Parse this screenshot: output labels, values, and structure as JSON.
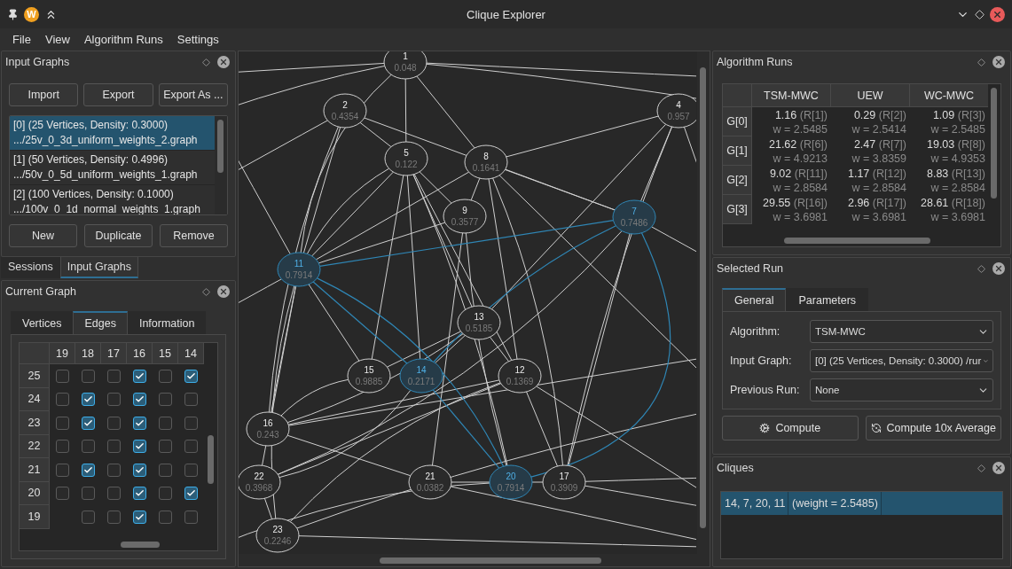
{
  "window": {
    "logo": "W",
    "title": "Clique Explorer"
  },
  "menu": [
    "File",
    "View",
    "Algorithm Runs",
    "Settings"
  ],
  "input_graphs": {
    "title": "Input Graphs",
    "top_buttons": [
      "Import",
      "Export",
      "Export As ..."
    ],
    "items": [
      {
        "line1": "[0] (25 Vertices, Density: 0.3000)",
        "line2": ".../25v_0_3d_uniform_weights_2.graph",
        "selected": true
      },
      {
        "line1": "[1] (50 Vertices, Density: 0.4996)",
        "line2": ".../50v_0_5d_uniform_weights_1.graph",
        "selected": false
      },
      {
        "line1": "[2] (100 Vertices, Density: 0.1000)",
        "line2": ".../100v_0_1d_normal_weights_1.graph",
        "selected": false
      }
    ],
    "bottom_buttons": [
      "New",
      "Duplicate",
      "Remove"
    ]
  },
  "left_tabs": [
    {
      "label": "Sessions",
      "selected": false
    },
    {
      "label": "Input Graphs",
      "selected": true
    }
  ],
  "current_graph": {
    "title": "Current Graph",
    "tabs": [
      {
        "label": "Vertices",
        "selected": false
      },
      {
        "label": "Edges",
        "selected": true
      },
      {
        "label": "Information",
        "selected": false
      }
    ],
    "columns": [
      "19",
      "18",
      "17",
      "16",
      "15",
      "14"
    ],
    "rows": [
      {
        "label": "25",
        "cells": [
          {
            "kind": "checkbox",
            "checked": false
          },
          {
            "kind": "checkbox",
            "checked": false
          },
          {
            "kind": "checkbox",
            "checked": false
          },
          {
            "kind": "checkbox",
            "checked": true
          },
          {
            "kind": "checkbox",
            "checked": false
          },
          {
            "kind": "checkbox",
            "checked": true
          }
        ]
      },
      {
        "label": "24",
        "cells": [
          {
            "kind": "checkbox",
            "checked": false
          },
          {
            "kind": "checkbox",
            "checked": true
          },
          {
            "kind": "checkbox",
            "checked": false
          },
          {
            "kind": "checkbox",
            "checked": true
          },
          {
            "kind": "checkbox",
            "checked": false
          },
          {
            "kind": "checkbox",
            "checked": false
          }
        ]
      },
      {
        "label": "23",
        "cells": [
          {
            "kind": "checkbox",
            "checked": false
          },
          {
            "kind": "checkbox",
            "checked": true
          },
          {
            "kind": "checkbox",
            "checked": false
          },
          {
            "kind": "checkbox",
            "checked": true
          },
          {
            "kind": "checkbox",
            "checked": false
          },
          {
            "kind": "checkbox",
            "checked": false
          }
        ]
      },
      {
        "label": "22",
        "cells": [
          {
            "kind": "checkbox",
            "checked": false
          },
          {
            "kind": "checkbox",
            "checked": false
          },
          {
            "kind": "checkbox",
            "checked": false
          },
          {
            "kind": "checkbox",
            "checked": true
          },
          {
            "kind": "checkbox",
            "checked": false
          },
          {
            "kind": "checkbox",
            "checked": false
          }
        ]
      },
      {
        "label": "21",
        "cells": [
          {
            "kind": "checkbox",
            "checked": false
          },
          {
            "kind": "checkbox",
            "checked": true
          },
          {
            "kind": "checkbox",
            "checked": false
          },
          {
            "kind": "checkbox",
            "checked": true
          },
          {
            "kind": "checkbox",
            "checked": false
          },
          {
            "kind": "checkbox",
            "checked": false
          }
        ]
      },
      {
        "label": "20",
        "cells": [
          {
            "kind": "checkbox",
            "checked": false
          },
          {
            "kind": "checkbox",
            "checked": false
          },
          {
            "kind": "checkbox",
            "checked": false
          },
          {
            "kind": "checkbox",
            "checked": true
          },
          {
            "kind": "checkbox",
            "checked": false
          },
          {
            "kind": "checkbox",
            "checked": true
          }
        ]
      },
      {
        "label": "19",
        "cells": [
          {
            "kind": "blank"
          },
          {
            "kind": "checkbox",
            "checked": false
          },
          {
            "kind": "checkbox",
            "checked": false
          },
          {
            "kind": "checkbox",
            "checked": true
          },
          {
            "kind": "checkbox",
            "checked": false
          },
          {
            "kind": "checkbox",
            "checked": false
          }
        ]
      }
    ]
  },
  "graph": {
    "nodes": [
      {
        "label": "1",
        "weight": "0.048",
        "selected": false
      },
      {
        "label": "2",
        "weight": "0.4354",
        "selected": false
      },
      {
        "label": "4",
        "weight": "0.957",
        "selected": false
      },
      {
        "label": "5",
        "weight": "0.122",
        "selected": false
      },
      {
        "label": "8",
        "weight": "0.1641",
        "selected": false
      },
      {
        "label": "9",
        "weight": "0.3577",
        "selected": false
      },
      {
        "label": "7",
        "weight": "0.7486",
        "selected": true
      },
      {
        "label": "11",
        "weight": "0.7914",
        "selected": true
      },
      {
        "label": "13",
        "weight": "0.5185",
        "selected": false
      },
      {
        "label": "15",
        "weight": "0.9885",
        "selected": false
      },
      {
        "label": "14",
        "weight": "0.2171",
        "selected": true
      },
      {
        "label": "12",
        "weight": "0.1369",
        "selected": false
      },
      {
        "label": "16",
        "weight": "0.243",
        "selected": false
      },
      {
        "label": "22",
        "weight": "0.3968",
        "selected": false
      },
      {
        "label": "21",
        "weight": "0.0382",
        "selected": false
      },
      {
        "label": "20",
        "weight": "0.7914",
        "selected": true
      },
      {
        "label": "17",
        "weight": "0.3909",
        "selected": false
      },
      {
        "label": "23",
        "weight": "0.2246",
        "selected": false
      }
    ]
  },
  "algorithm_runs": {
    "title": "Algorithm Runs",
    "columns": [
      "TSM-MWC",
      "UEW",
      "WC-MWC"
    ],
    "rows": [
      {
        "label": "G[0]",
        "cells": [
          {
            "time": "1.16",
            "run": "(R[1])",
            "weight": "w = 2.5485"
          },
          {
            "time": "0.29",
            "run": "(R[2])",
            "weight": "w = 2.5414"
          },
          {
            "time": "1.09",
            "run": "(R[3])",
            "weight": "w = 2.5485"
          }
        ]
      },
      {
        "label": "G[1]",
        "cells": [
          {
            "time": "21.62",
            "run": "(R[6])",
            "weight": "w = 4.9213"
          },
          {
            "time": "2.47",
            "run": "(R[7])",
            "weight": "w = 3.8359"
          },
          {
            "time": "19.03",
            "run": "(R[8])",
            "weight": "w = 4.9353"
          }
        ]
      },
      {
        "label": "G[2]",
        "cells": [
          {
            "time": "9.02",
            "run": "(R[11])",
            "weight": "w = 2.8584"
          },
          {
            "time": "1.17",
            "run": "(R[12])",
            "weight": "w = 2.8584"
          },
          {
            "time": "8.83",
            "run": "(R[13])",
            "weight": "w = 2.8584"
          }
        ]
      },
      {
        "label": "G[3]",
        "cells": [
          {
            "time": "29.55",
            "run": "(R[16])",
            "weight": "w = 3.6981"
          },
          {
            "time": "2.96",
            "run": "(R[17])",
            "weight": "w = 3.6981"
          },
          {
            "time": "28.61",
            "run": "(R[18])",
            "weight": "w = 3.6981"
          }
        ]
      }
    ]
  },
  "selected_run": {
    "title": "Selected Run",
    "tabs": [
      {
        "label": "General",
        "selected": true
      },
      {
        "label": "Parameters",
        "selected": false
      }
    ],
    "fields": [
      {
        "label": "Algorithm:",
        "value": "TSM-MWC"
      },
      {
        "label": "Input Graph:",
        "value": "[0] (25 Vertices, Density: 0.3000) /rur"
      },
      {
        "label": "Previous Run:",
        "value": "None"
      }
    ],
    "buttons": [
      {
        "kind": "single",
        "label": "Compute"
      },
      {
        "kind": "average",
        "label": "Compute 10x Average"
      }
    ]
  },
  "cliques": {
    "title": "Cliques",
    "rows": [
      {
        "vertices": "14, 7, 20, 11",
        "weight": "(weight = 2.5485)",
        "selected": true
      }
    ]
  }
}
